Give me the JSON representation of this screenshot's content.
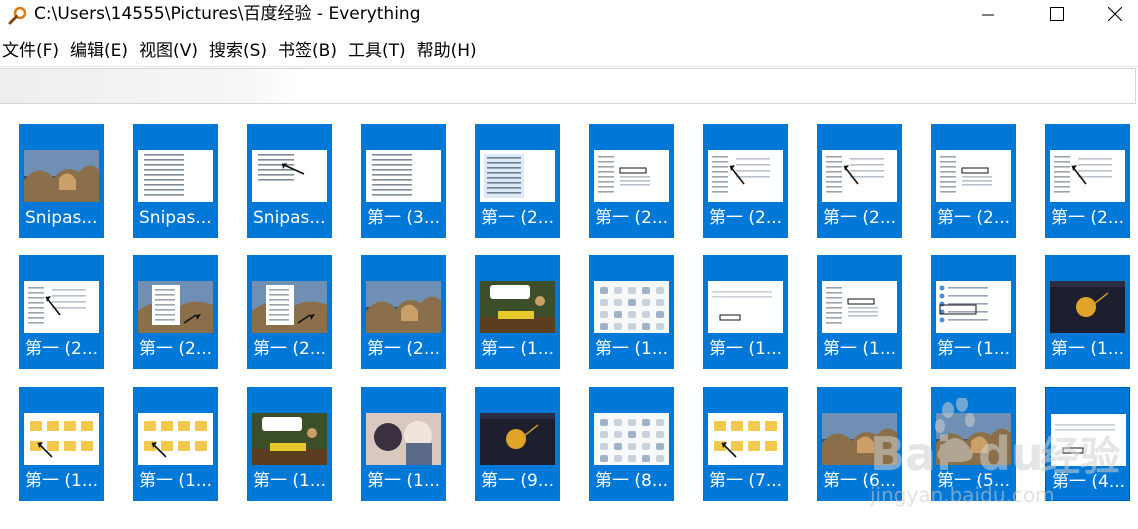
{
  "window": {
    "title": "C:\\Users\\14555\\Pictures\\百度经验 - Everything",
    "app_icon": "magnifier-icon",
    "controls": [
      "minimize-icon",
      "maximize-icon",
      "close-icon"
    ]
  },
  "menu": {
    "items": [
      "文件(F)",
      "编辑(E)",
      "视图(V)",
      "搜索(S)",
      "书签(B)",
      "工具(T)",
      "帮助(H)"
    ]
  },
  "search": {
    "value": "",
    "placeholder": ""
  },
  "results": {
    "items": [
      {
        "label": "Snipas...",
        "thumb": "landscape"
      },
      {
        "label": "Snipas...",
        "thumb": "list"
      },
      {
        "label": "Snipas...",
        "thumb": "list-arrow"
      },
      {
        "label": "第一 (3...",
        "thumb": "list"
      },
      {
        "label": "第一 (2...",
        "thumb": "explorer"
      },
      {
        "label": "第一 (2...",
        "thumb": "window-dialog"
      },
      {
        "label": "第一 (2...",
        "thumb": "window-arrow"
      },
      {
        "label": "第一 (2...",
        "thumb": "window-arrow"
      },
      {
        "label": "第一 (2...",
        "thumb": "window-dialog"
      },
      {
        "label": "第一 (2...",
        "thumb": "window-arrow"
      },
      {
        "label": "第一 (2...",
        "thumb": "window-arrow"
      },
      {
        "label": "第一 (2...",
        "thumb": "landscape-menu"
      },
      {
        "label": "第一 (2...",
        "thumb": "landscape-menu"
      },
      {
        "label": "第一 (2...",
        "thumb": "landscape"
      },
      {
        "label": "第一 (1...",
        "thumb": "game"
      },
      {
        "label": "第一 (1...",
        "thumb": "icons-grid"
      },
      {
        "label": "第一 (1...",
        "thumb": "dialog-small"
      },
      {
        "label": "第一 (1...",
        "thumb": "window-dialog"
      },
      {
        "label": "第一 (1...",
        "thumb": "settings"
      },
      {
        "label": "第一 (1...",
        "thumb": "dark-app"
      },
      {
        "label": "第一 (1...",
        "thumb": "folders"
      },
      {
        "label": "第一 (1...",
        "thumb": "folders"
      },
      {
        "label": "第一 (1...",
        "thumb": "game"
      },
      {
        "label": "第一 (1...",
        "thumb": "anime"
      },
      {
        "label": "第一 (9...",
        "thumb": "dark-app"
      },
      {
        "label": "第一 (8...",
        "thumb": "icons-grid"
      },
      {
        "label": "第一 (7...",
        "thumb": "folders"
      },
      {
        "label": "第一 (6...",
        "thumb": "landscape"
      },
      {
        "label": "第一 (5...",
        "thumb": "landscape"
      },
      {
        "label": "第一 (4...",
        "thumb": "dialog-small"
      }
    ]
  },
  "watermark": {
    "text": "Baidu经验",
    "url_text": "jingyan.baidu.com"
  },
  "colors": {
    "tile": "#0078d7",
    "tile_text": "#ffffff"
  }
}
